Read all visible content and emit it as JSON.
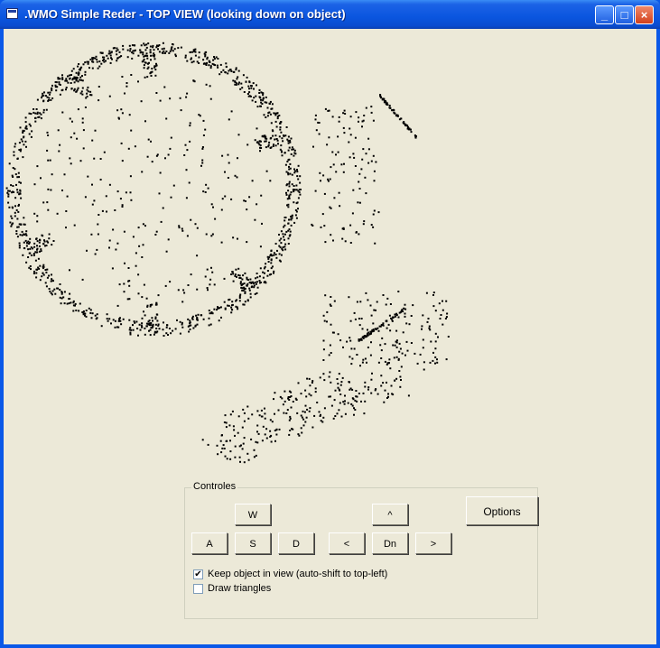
{
  "window": {
    "title": ".WMO Simple Reder - TOP VIEW (looking down on object)",
    "minimize_glyph": "_",
    "maximize_glyph": "□",
    "close_glyph": "×"
  },
  "controls": {
    "group_label": "Controles",
    "buttons": {
      "w": "W",
      "a": "A",
      "s": "S",
      "d": "D",
      "up": "^",
      "left": "<",
      "down": "Dn",
      "right": ">",
      "options": "Options"
    },
    "checkboxes": {
      "keep_in_view": {
        "label": "Keep object in view (auto-shift to top-left)",
        "checked": true
      },
      "draw_triangles": {
        "label": "Draw triangles",
        "checked": false
      }
    }
  },
  "colors": {
    "titlebar": "#0a55df",
    "client_bg": "#ece9d8",
    "point": "#000000",
    "close_button": "#d2401c"
  }
}
